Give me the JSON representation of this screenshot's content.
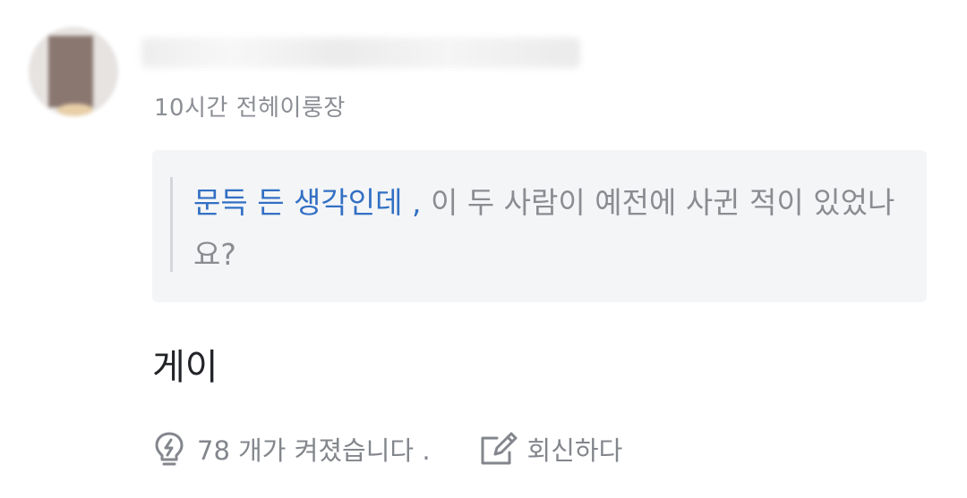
{
  "comment": {
    "time_ago": "10시간 전",
    "author_title": "헤이룽장",
    "quote": {
      "author": "문득 든 생각인데 ,",
      "text": "이 두 사람이 예전에 사귄 적이 있었나요?"
    },
    "body": "게이",
    "actions": {
      "upvotes_label": "78 개가 켜졌습니다 .",
      "reply_label": "회신하다"
    }
  },
  "icons": {
    "upvote": "lightbulb-bolt-icon",
    "reply": "edit-pencil-icon"
  },
  "colors": {
    "link": "#3270c4",
    "meta": "#8b8e94",
    "quote_bg": "#f4f5f7",
    "body_text": "#222428"
  }
}
